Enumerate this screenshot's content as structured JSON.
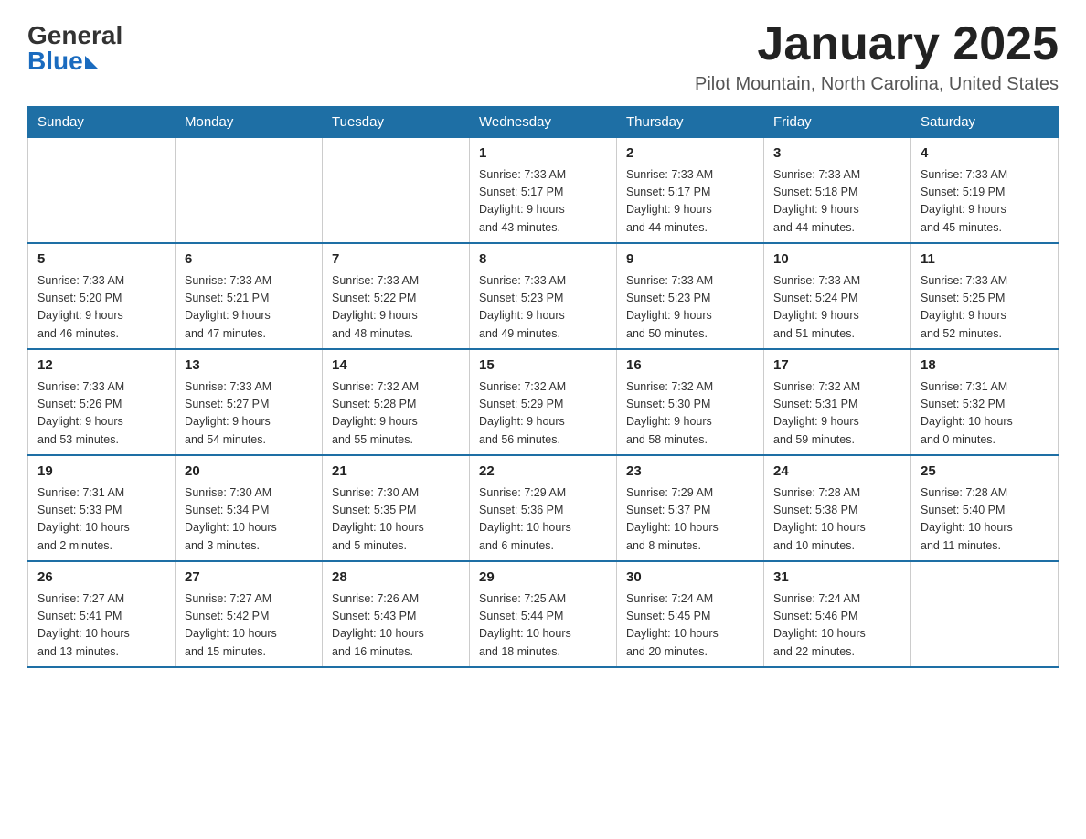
{
  "logo": {
    "general": "General",
    "blue": "Blue"
  },
  "title": "January 2025",
  "subtitle": "Pilot Mountain, North Carolina, United States",
  "days_of_week": [
    "Sunday",
    "Monday",
    "Tuesday",
    "Wednesday",
    "Thursday",
    "Friday",
    "Saturday"
  ],
  "weeks": [
    [
      {
        "day": "",
        "info": ""
      },
      {
        "day": "",
        "info": ""
      },
      {
        "day": "",
        "info": ""
      },
      {
        "day": "1",
        "info": "Sunrise: 7:33 AM\nSunset: 5:17 PM\nDaylight: 9 hours\nand 43 minutes."
      },
      {
        "day": "2",
        "info": "Sunrise: 7:33 AM\nSunset: 5:17 PM\nDaylight: 9 hours\nand 44 minutes."
      },
      {
        "day": "3",
        "info": "Sunrise: 7:33 AM\nSunset: 5:18 PM\nDaylight: 9 hours\nand 44 minutes."
      },
      {
        "day": "4",
        "info": "Sunrise: 7:33 AM\nSunset: 5:19 PM\nDaylight: 9 hours\nand 45 minutes."
      }
    ],
    [
      {
        "day": "5",
        "info": "Sunrise: 7:33 AM\nSunset: 5:20 PM\nDaylight: 9 hours\nand 46 minutes."
      },
      {
        "day": "6",
        "info": "Sunrise: 7:33 AM\nSunset: 5:21 PM\nDaylight: 9 hours\nand 47 minutes."
      },
      {
        "day": "7",
        "info": "Sunrise: 7:33 AM\nSunset: 5:22 PM\nDaylight: 9 hours\nand 48 minutes."
      },
      {
        "day": "8",
        "info": "Sunrise: 7:33 AM\nSunset: 5:23 PM\nDaylight: 9 hours\nand 49 minutes."
      },
      {
        "day": "9",
        "info": "Sunrise: 7:33 AM\nSunset: 5:23 PM\nDaylight: 9 hours\nand 50 minutes."
      },
      {
        "day": "10",
        "info": "Sunrise: 7:33 AM\nSunset: 5:24 PM\nDaylight: 9 hours\nand 51 minutes."
      },
      {
        "day": "11",
        "info": "Sunrise: 7:33 AM\nSunset: 5:25 PM\nDaylight: 9 hours\nand 52 minutes."
      }
    ],
    [
      {
        "day": "12",
        "info": "Sunrise: 7:33 AM\nSunset: 5:26 PM\nDaylight: 9 hours\nand 53 minutes."
      },
      {
        "day": "13",
        "info": "Sunrise: 7:33 AM\nSunset: 5:27 PM\nDaylight: 9 hours\nand 54 minutes."
      },
      {
        "day": "14",
        "info": "Sunrise: 7:32 AM\nSunset: 5:28 PM\nDaylight: 9 hours\nand 55 minutes."
      },
      {
        "day": "15",
        "info": "Sunrise: 7:32 AM\nSunset: 5:29 PM\nDaylight: 9 hours\nand 56 minutes."
      },
      {
        "day": "16",
        "info": "Sunrise: 7:32 AM\nSunset: 5:30 PM\nDaylight: 9 hours\nand 58 minutes."
      },
      {
        "day": "17",
        "info": "Sunrise: 7:32 AM\nSunset: 5:31 PM\nDaylight: 9 hours\nand 59 minutes."
      },
      {
        "day": "18",
        "info": "Sunrise: 7:31 AM\nSunset: 5:32 PM\nDaylight: 10 hours\nand 0 minutes."
      }
    ],
    [
      {
        "day": "19",
        "info": "Sunrise: 7:31 AM\nSunset: 5:33 PM\nDaylight: 10 hours\nand 2 minutes."
      },
      {
        "day": "20",
        "info": "Sunrise: 7:30 AM\nSunset: 5:34 PM\nDaylight: 10 hours\nand 3 minutes."
      },
      {
        "day": "21",
        "info": "Sunrise: 7:30 AM\nSunset: 5:35 PM\nDaylight: 10 hours\nand 5 minutes."
      },
      {
        "day": "22",
        "info": "Sunrise: 7:29 AM\nSunset: 5:36 PM\nDaylight: 10 hours\nand 6 minutes."
      },
      {
        "day": "23",
        "info": "Sunrise: 7:29 AM\nSunset: 5:37 PM\nDaylight: 10 hours\nand 8 minutes."
      },
      {
        "day": "24",
        "info": "Sunrise: 7:28 AM\nSunset: 5:38 PM\nDaylight: 10 hours\nand 10 minutes."
      },
      {
        "day": "25",
        "info": "Sunrise: 7:28 AM\nSunset: 5:40 PM\nDaylight: 10 hours\nand 11 minutes."
      }
    ],
    [
      {
        "day": "26",
        "info": "Sunrise: 7:27 AM\nSunset: 5:41 PM\nDaylight: 10 hours\nand 13 minutes."
      },
      {
        "day": "27",
        "info": "Sunrise: 7:27 AM\nSunset: 5:42 PM\nDaylight: 10 hours\nand 15 minutes."
      },
      {
        "day": "28",
        "info": "Sunrise: 7:26 AM\nSunset: 5:43 PM\nDaylight: 10 hours\nand 16 minutes."
      },
      {
        "day": "29",
        "info": "Sunrise: 7:25 AM\nSunset: 5:44 PM\nDaylight: 10 hours\nand 18 minutes."
      },
      {
        "day": "30",
        "info": "Sunrise: 7:24 AM\nSunset: 5:45 PM\nDaylight: 10 hours\nand 20 minutes."
      },
      {
        "day": "31",
        "info": "Sunrise: 7:24 AM\nSunset: 5:46 PM\nDaylight: 10 hours\nand 22 minutes."
      },
      {
        "day": "",
        "info": ""
      }
    ]
  ]
}
